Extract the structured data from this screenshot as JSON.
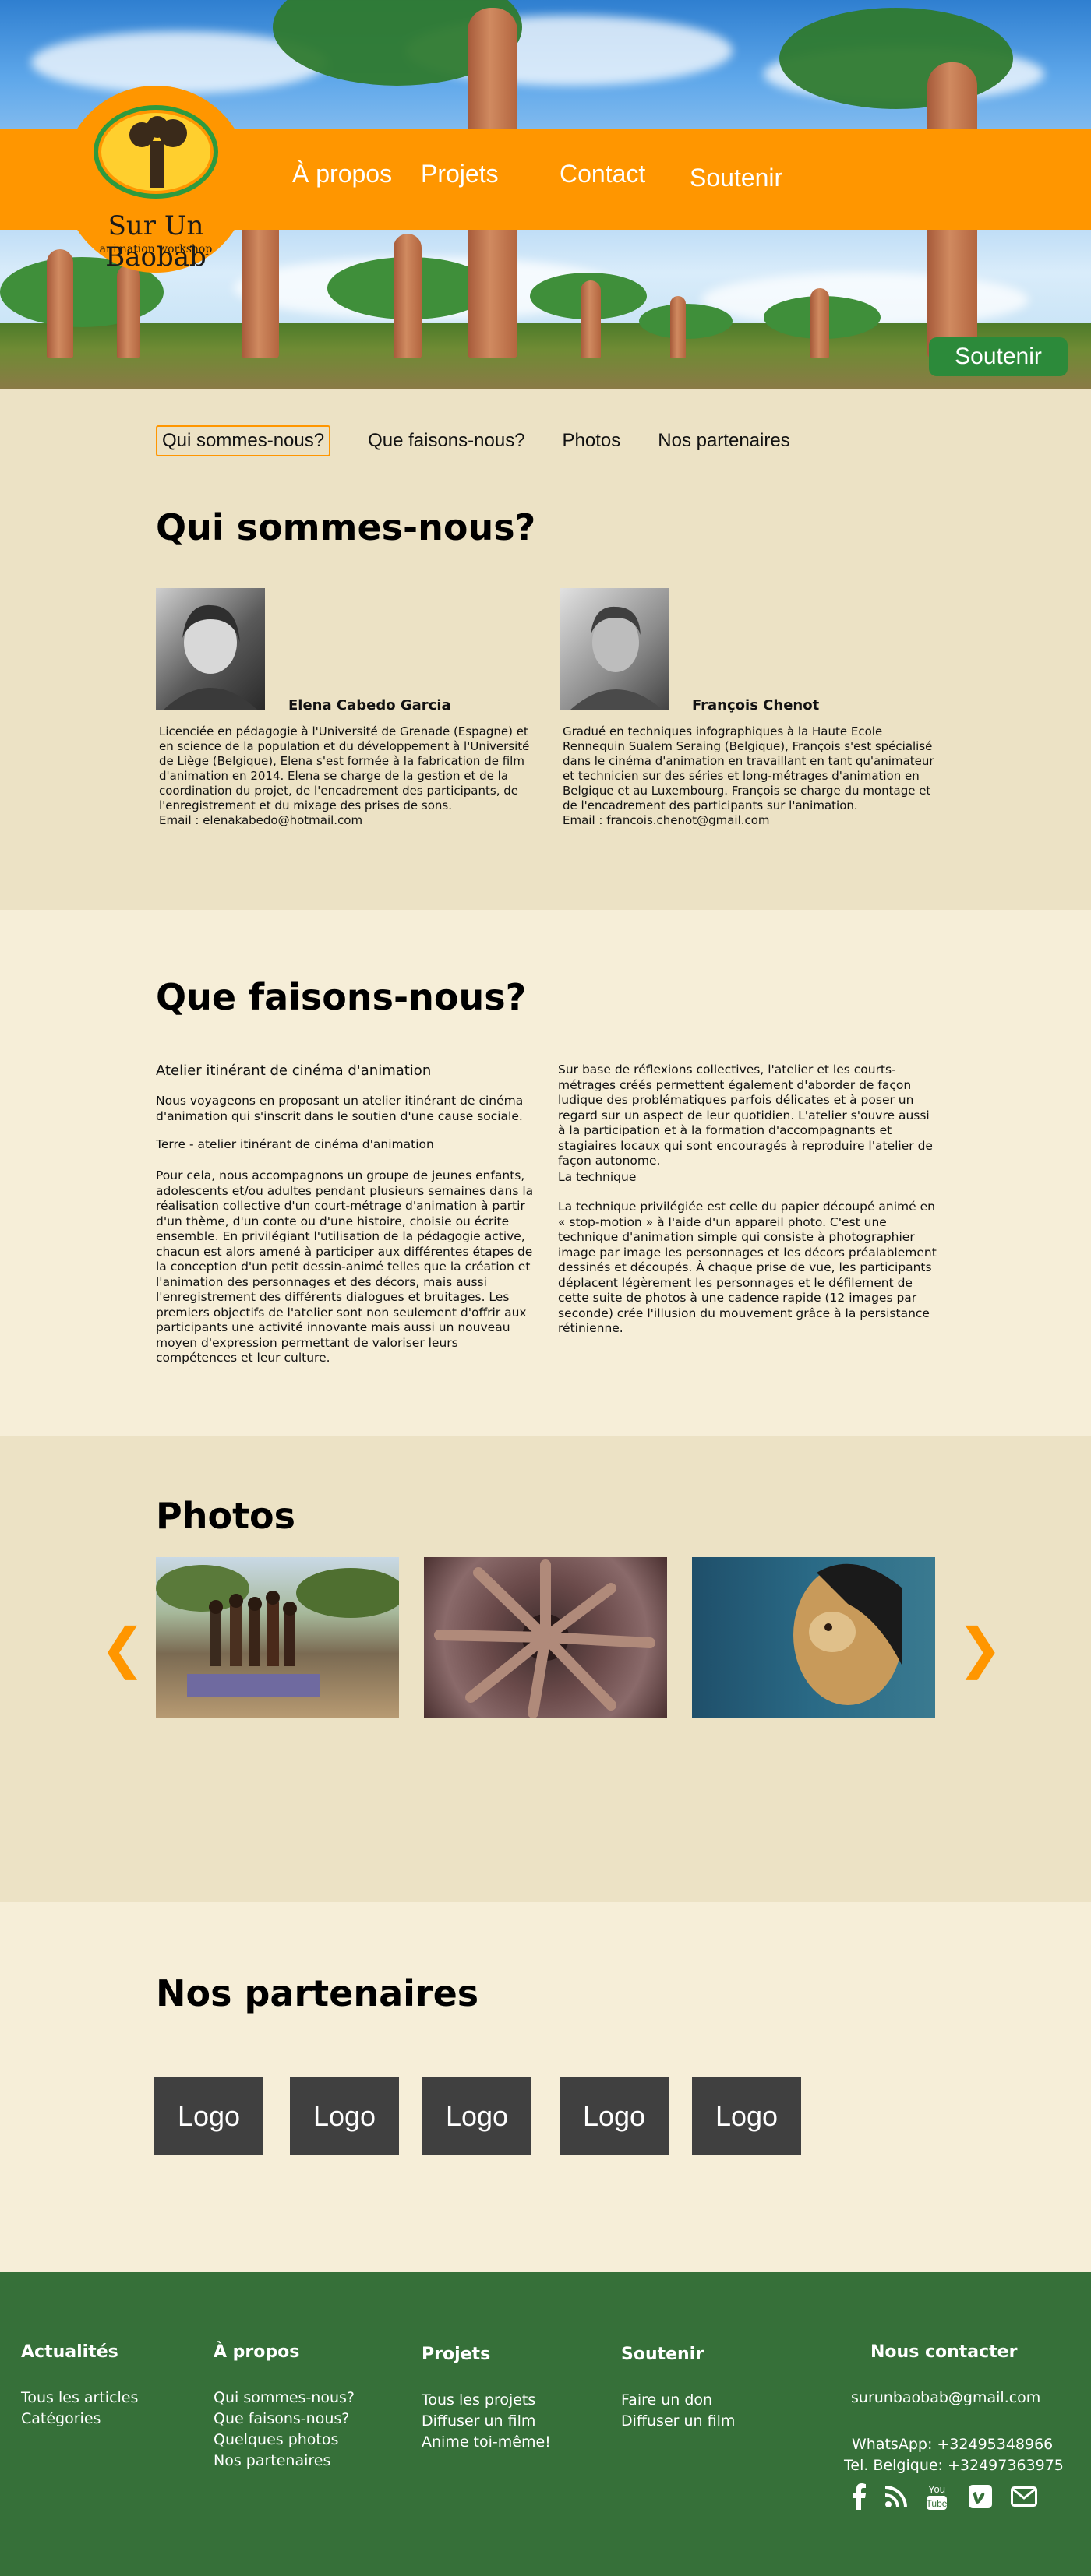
{
  "logo": {
    "title": "Sur Un Baobab",
    "subtitle": "animation workshop"
  },
  "nav": {
    "about": "À propos",
    "projects": "Projets",
    "contact": "Contact",
    "support": "Soutenir"
  },
  "hero": {
    "support_button": "Soutenir"
  },
  "subnav": {
    "items": [
      "Qui sommes-nous?",
      "Que faisons-nous?",
      "Photos",
      "Nos partenaires"
    ]
  },
  "who": {
    "title": "Qui sommes-nous?",
    "people": [
      {
        "name": "Elena Cabedo Garcia",
        "bio": "Licenciée en pédagogie à l'Université de Grenade (Espagne) et en science de la population et du développement à l'Université de Liège (Belgique), Elena s'est formée à la fabrication de film d'animation en 2014. Elena se charge de la gestion et de la coordination du projet, de l'encadrement des participants, de l'enregistrement et du mixage des prises de sons.",
        "email": "Email : elenakabedo@hotmail.com"
      },
      {
        "name": "François Chenot",
        "bio": "Gradué en techniques infographiques à la Haute Ecole Rennequin Sualem Seraing (Belgique), François s'est spécialisé dans le cinéma d'animation en travaillant en tant qu'animateur et technicien sur des séries et long-métrages d'animation en Belgique et au Luxembourg. François se charge du montage et de l'encadrement des participants sur l'animation.",
        "email": "Email : francois.chenot@gmail.com"
      }
    ]
  },
  "what": {
    "title": "Que faisons-nous?",
    "left_heading": "Atelier itinérant de cinéma d'animation",
    "left_p1": "Nous voyageons en proposant un atelier itinérant de cinéma d'animation qui s'inscrit dans le soutien d'une cause sociale.",
    "left_p2": "Terre - atelier itinérant de cinéma d'animation",
    "left_p3": "Pour cela, nous accompagnons un groupe de jeunes enfants, adolescents et/ou adultes pendant plusieurs semaines dans la réalisation collective d'un court-métrage d'animation à partir d'un thème, d'un conte ou d'une histoire, choisie ou écrite ensemble. En privilégiant l'utilisation de la pédagogie active, chacun est alors amené à participer aux différentes étapes de la conception d'un petit dessin-animé telles que la création et l'animation des personnages et des décors, mais aussi l'enregistrement des différents dialogues et bruitages. Les premiers objectifs de l'atelier sont non seulement d'offrir aux participants une activité innovante mais aussi un nouveau moyen d'expression permettant de valoriser leurs compétences et leur culture.",
    "right_p1": "Sur base de réflexions collectives, l'atelier et les courts-métrages créés permettent également d'aborder de façon ludique des problématiques parfois délicates et à poser un regard sur un aspect de leur quotidien. L'atelier s'ouvre aussi à la participation et à la formation d'accompagnants et stagiaires locaux qui sont encouragés à reproduire l'atelier de façon autonome.",
    "right_heading": "La technique",
    "right_p2": "La technique privilégiée est celle du papier découpé animé en « stop-motion » à l'aide d'un appareil photo. C'est une technique d'animation simple qui consiste à photographier image par image les personnages et les décors préalablement dessinés et découpés. À chaque prise de vue, les participants déplacent légèrement les personnages et le défilement de cette suite de photos à une cadence rapide (12 images par seconde) crée l'illusion du mouvement grâce à la persistance rétinienne."
  },
  "photos": {
    "title": "Photos",
    "prev_icon": "chevron-left-icon",
    "next_icon": "chevron-right-icon"
  },
  "partners": {
    "title": "Nos partenaires",
    "logos": [
      "Logo",
      "Logo",
      "Logo",
      "Logo",
      "Logo"
    ]
  },
  "footer": {
    "news": {
      "title": "Actualités",
      "links": [
        "Tous les articles",
        "Catégories"
      ]
    },
    "about": {
      "title": "À propos",
      "links": [
        "Qui sommes-nous?",
        "Que faisons-nous?",
        "Quelques photos",
        "Nos partenaires"
      ]
    },
    "projects": {
      "title": "Projets",
      "links": [
        "Tous les projets",
        "Diffuser un film",
        "Anime toi-même!"
      ]
    },
    "support": {
      "title": "Soutenir",
      "links": [
        "Faire un don",
        "Diffuser un film"
      ]
    },
    "contact": {
      "title": "Nous contacter",
      "email": "surunbaobab@gmail.com",
      "whatsapp": "WhatsApp: +32495348966",
      "phone": "Tel. Belgique: +32497363975"
    },
    "social": [
      "facebook-icon",
      "rss-icon",
      "youtube-icon",
      "vimeo-icon",
      "email-icon"
    ]
  },
  "colors": {
    "orange": "#ff9600",
    "green": "#2c8a3a",
    "footer_green": "#367039",
    "beige_dark": "#ece2c5",
    "beige_light": "#f6eed8"
  }
}
